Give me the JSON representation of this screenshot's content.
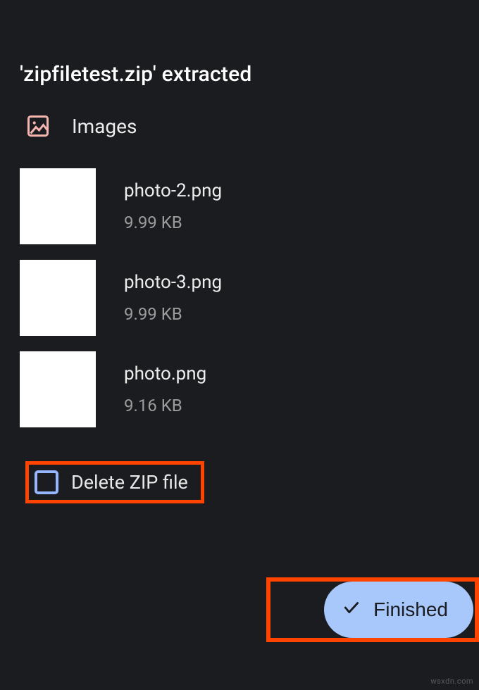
{
  "title": "'zipfiletest.zip' extracted",
  "section": {
    "icon": "image-icon",
    "label": "Images"
  },
  "files": [
    {
      "name": "photo-2.png",
      "size": "9.99 KB"
    },
    {
      "name": "photo-3.png",
      "size": "9.99 KB"
    },
    {
      "name": "photo.png",
      "size": "9.16 KB"
    }
  ],
  "deleteOption": {
    "label": "Delete ZIP file",
    "checked": false
  },
  "finished": {
    "label": "Finished",
    "icon": "check-icon"
  },
  "colors": {
    "accent": "#a8c7fa",
    "highlight": "#ff4400",
    "iconPink": "#f5b5b0"
  },
  "watermark": "wsxdn.com"
}
